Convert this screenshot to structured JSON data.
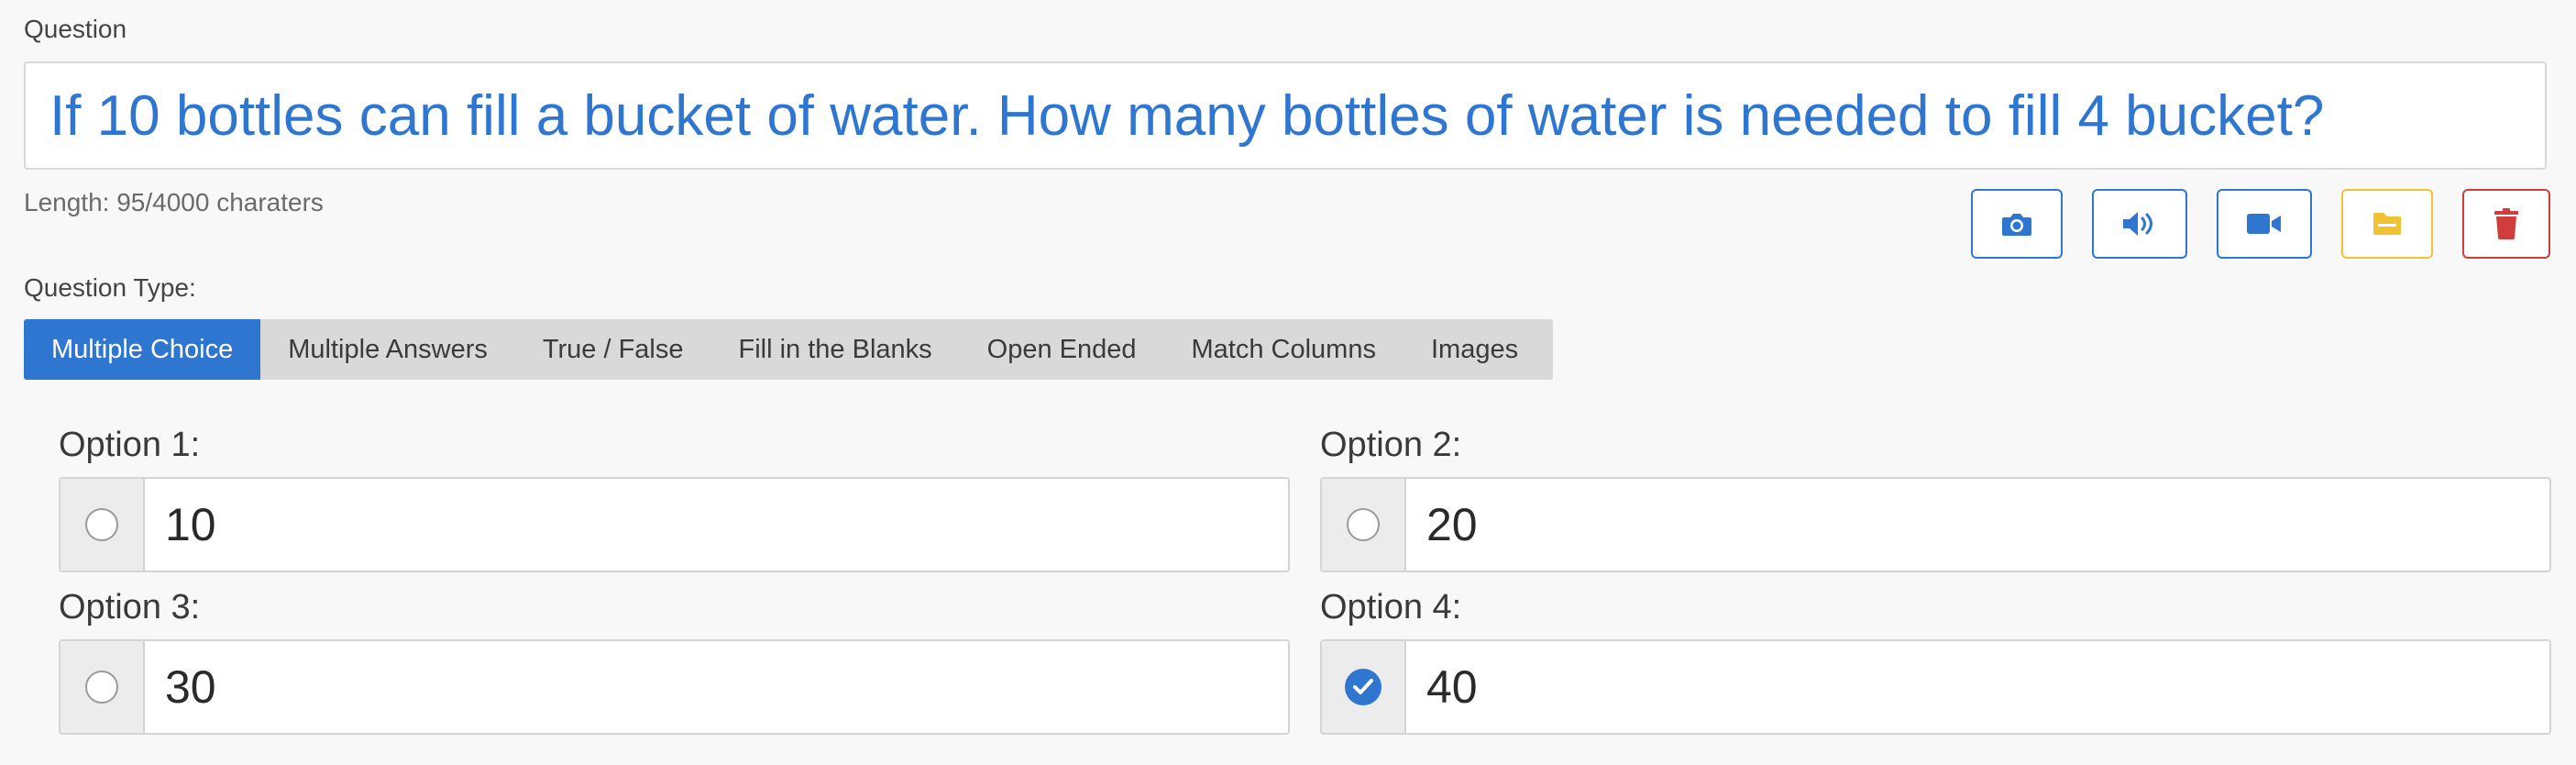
{
  "question": {
    "label": "Question",
    "text": "If 10 bottles can fill a bucket of water. How many bottles of water is needed to fill 4 bucket?",
    "length_text": "Length: 95/4000 charaters"
  },
  "media_buttons": [
    {
      "icon": "camera-icon",
      "color": "#2f76d1"
    },
    {
      "icon": "volume-icon",
      "color": "#2f76d1"
    },
    {
      "icon": "video-icon",
      "color": "#2f76d1"
    },
    {
      "icon": "folder-icon",
      "color": "#f1c232"
    },
    {
      "icon": "trash-icon",
      "color": "#d13c3c"
    }
  ],
  "question_type": {
    "label": "Question Type:",
    "tabs": [
      "Multiple Choice",
      "Multiple Answers",
      "True / False",
      "Fill in the Blanks",
      "Open Ended",
      "Match Columns",
      "Images"
    ],
    "selected": "Multiple Choice"
  },
  "options": [
    {
      "label": "Option 1:",
      "value": "10",
      "checked": false
    },
    {
      "label": "Option 2:",
      "value": "20",
      "checked": false
    },
    {
      "label": "Option 3:",
      "value": "30",
      "checked": false
    },
    {
      "label": "Option 4:",
      "value": "40",
      "checked": true
    }
  ],
  "colors": {
    "accent": "#2f76d1",
    "warning": "#f1c232",
    "danger": "#d13c3c"
  }
}
